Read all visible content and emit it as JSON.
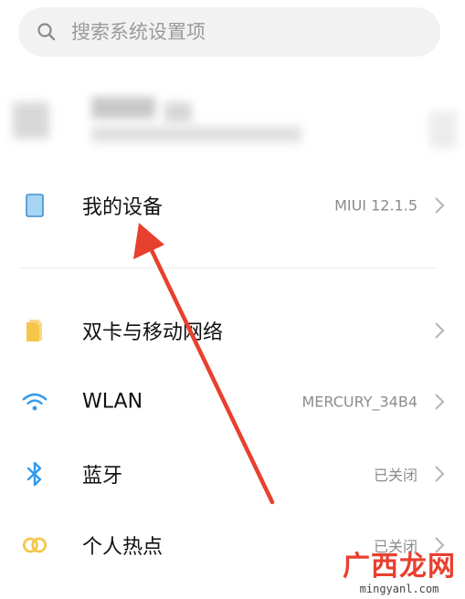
{
  "search": {
    "placeholder": "搜索系统设置项",
    "icon": "search-icon"
  },
  "account": {
    "blurred": true
  },
  "menu": {
    "device": {
      "label": "我的设备",
      "value": "MIUI 12.1.5",
      "icon": "tablet-icon",
      "color": "#a7d6f2"
    },
    "items": [
      {
        "label": "双卡与移动网络",
        "value": "",
        "icon": "sim-card-icon",
        "color": "#f6c64a"
      },
      {
        "label": "WLAN",
        "value": "MERCURY_34B4",
        "icon": "wifi-icon",
        "color": "#2f9bf0"
      },
      {
        "label": "蓝牙",
        "value": "已关闭",
        "icon": "bluetooth-icon",
        "color": "#2f9bf0"
      },
      {
        "label": "个人热点",
        "value": "已关闭",
        "icon": "hotspot-icon",
        "color": "#f6c64a"
      }
    ]
  },
  "watermark": {
    "brand": "广西龙网",
    "url": "mingyanl.com"
  },
  "annotation": {
    "color": "#e8402f"
  }
}
